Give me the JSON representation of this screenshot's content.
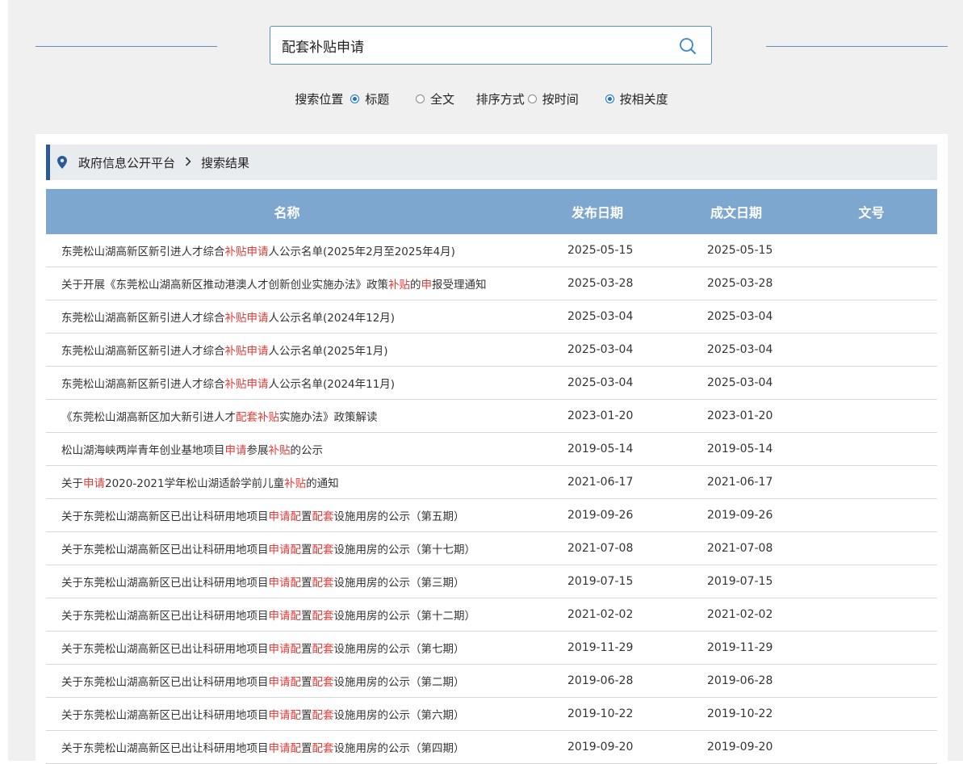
{
  "search": {
    "query": "配套补贴申请"
  },
  "options": {
    "location_label": "搜索位置",
    "location_title": "标题",
    "location_fulltext": "全文",
    "sort_label": "排序方式",
    "sort_time": "按时间",
    "sort_relevance": "按相关度",
    "accent_color": "#1a73c9"
  },
  "breadcrumb": {
    "home": "政府信息公开平台",
    "current": "搜索结果"
  },
  "table": {
    "headers": [
      "名称",
      "发布日期",
      "成文日期",
      "文号"
    ],
    "highlight_color": "#e53935",
    "rows": [
      {
        "title": [
          [
            "东莞松山湖高新区新引进人才综合",
            0
          ],
          [
            "补贴申请",
            1
          ],
          [
            "人公示名单(2025年2月至2025年4月)",
            0
          ]
        ],
        "published": "2025-05-15",
        "written": "2025-05-15",
        "doc_no": ""
      },
      {
        "title": [
          [
            "关于开展《东莞松山湖高新区推动港澳人才创新创业实施办法》政策",
            0
          ],
          [
            "补贴",
            1
          ],
          [
            "的",
            0
          ],
          [
            "申",
            1
          ],
          [
            "报受理通知",
            0
          ]
        ],
        "published": "2025-03-28",
        "written": "2025-03-28",
        "doc_no": ""
      },
      {
        "title": [
          [
            "东莞松山湖高新区新引进人才综合",
            0
          ],
          [
            "补贴申请",
            1
          ],
          [
            "人公示名单(2024年12月)",
            0
          ]
        ],
        "published": "2025-03-04",
        "written": "2025-03-04",
        "doc_no": ""
      },
      {
        "title": [
          [
            "东莞松山湖高新区新引进人才综合",
            0
          ],
          [
            "补贴申请",
            1
          ],
          [
            "人公示名单(2025年1月)",
            0
          ]
        ],
        "published": "2025-03-04",
        "written": "2025-03-04",
        "doc_no": ""
      },
      {
        "title": [
          [
            "东莞松山湖高新区新引进人才综合",
            0
          ],
          [
            "补贴申请",
            1
          ],
          [
            "人公示名单(2024年11月)",
            0
          ]
        ],
        "published": "2025-03-04",
        "written": "2025-03-04",
        "doc_no": ""
      },
      {
        "title": [
          [
            "《东莞松山湖高新区加大新引进人才",
            0
          ],
          [
            "配套补贴",
            1
          ],
          [
            "实施办法》政策解读",
            0
          ]
        ],
        "published": "2023-01-20",
        "written": "2023-01-20",
        "doc_no": ""
      },
      {
        "title": [
          [
            "松山湖海峡两岸青年创业基地项目",
            0
          ],
          [
            "申请",
            1
          ],
          [
            "参展",
            0
          ],
          [
            "补贴",
            1
          ],
          [
            "的公示",
            0
          ]
        ],
        "published": "2019-05-14",
        "written": "2019-05-14",
        "doc_no": ""
      },
      {
        "title": [
          [
            "关于",
            0
          ],
          [
            "申请",
            1
          ],
          [
            "2020-2021学年松山湖适龄学前儿童",
            0
          ],
          [
            "补贴",
            1
          ],
          [
            "的通知",
            0
          ]
        ],
        "published": "2021-06-17",
        "written": "2021-06-17",
        "doc_no": ""
      },
      {
        "title": [
          [
            "关于东莞松山湖高新区已出让科研用地项目",
            0
          ],
          [
            "申请配",
            1
          ],
          [
            "置",
            0
          ],
          [
            "配套",
            1
          ],
          [
            "设施用房的公示（第五期）",
            0
          ]
        ],
        "published": "2019-09-26",
        "written": "2019-09-26",
        "doc_no": ""
      },
      {
        "title": [
          [
            "关于东莞松山湖高新区已出让科研用地项目",
            0
          ],
          [
            "申请配",
            1
          ],
          [
            "置",
            0
          ],
          [
            "配套",
            1
          ],
          [
            "设施用房的公示（第十七期）",
            0
          ]
        ],
        "published": "2021-07-08",
        "written": "2021-07-08",
        "doc_no": ""
      },
      {
        "title": [
          [
            "关于东莞松山湖高新区已出让科研用地项目",
            0
          ],
          [
            "申请配",
            1
          ],
          [
            "置",
            0
          ],
          [
            "配套",
            1
          ],
          [
            "设施用房的公示（第三期）",
            0
          ]
        ],
        "published": "2019-07-15",
        "written": "2019-07-15",
        "doc_no": ""
      },
      {
        "title": [
          [
            "关于东莞松山湖高新区已出让科研用地项目",
            0
          ],
          [
            "申请配",
            1
          ],
          [
            "置",
            0
          ],
          [
            "配套",
            1
          ],
          [
            "设施用房的公示（第十二期）",
            0
          ]
        ],
        "published": "2021-02-02",
        "written": "2021-02-02",
        "doc_no": ""
      },
      {
        "title": [
          [
            "关于东莞松山湖高新区已出让科研用地项目",
            0
          ],
          [
            "申请配",
            1
          ],
          [
            "置",
            0
          ],
          [
            "配套",
            1
          ],
          [
            "设施用房的公示（第七期）",
            0
          ]
        ],
        "published": "2019-11-29",
        "written": "2019-11-29",
        "doc_no": ""
      },
      {
        "title": [
          [
            "关于东莞松山湖高新区已出让科研用地项目",
            0
          ],
          [
            "申请配",
            1
          ],
          [
            "置",
            0
          ],
          [
            "配套",
            1
          ],
          [
            "设施用房的公示（第二期）",
            0
          ]
        ],
        "published": "2019-06-28",
        "written": "2019-06-28",
        "doc_no": ""
      },
      {
        "title": [
          [
            "关于东莞松山湖高新区已出让科研用地项目",
            0
          ],
          [
            "申请配",
            1
          ],
          [
            "置",
            0
          ],
          [
            "配套",
            1
          ],
          [
            "设施用房的公示（第六期）",
            0
          ]
        ],
        "published": "2019-10-22",
        "written": "2019-10-22",
        "doc_no": ""
      },
      {
        "title": [
          [
            "关于东莞松山湖高新区已出让科研用地项目",
            0
          ],
          [
            "申请配",
            1
          ],
          [
            "置",
            0
          ],
          [
            "配套",
            1
          ],
          [
            "设施用房的公示（第四期）",
            0
          ]
        ],
        "published": "2019-09-20",
        "written": "2019-09-20",
        "doc_no": ""
      }
    ]
  }
}
